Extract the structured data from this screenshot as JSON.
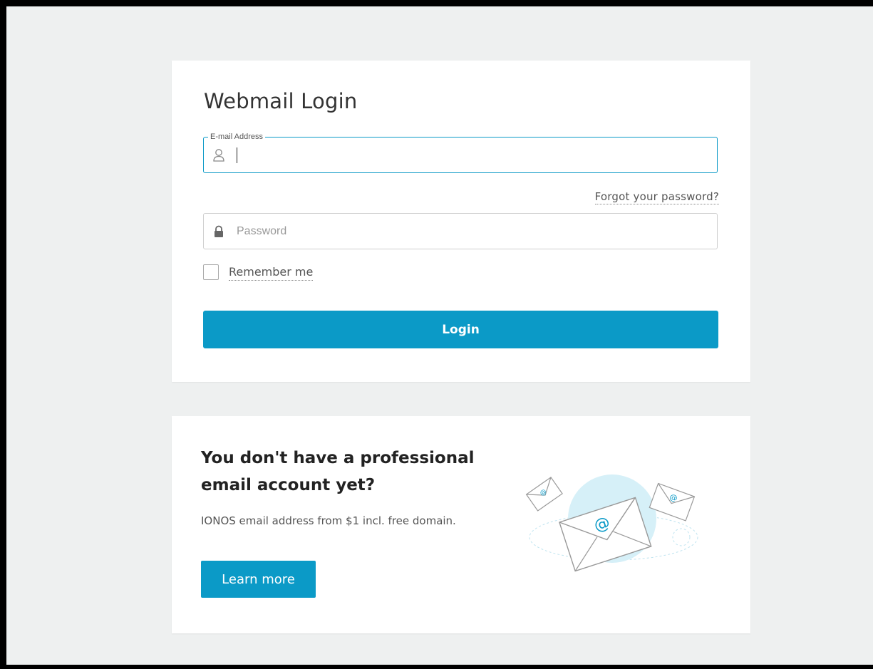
{
  "login": {
    "title": "Webmail Login",
    "email_label": "E-mail Address",
    "email_value": "",
    "password_placeholder": "Password",
    "password_value": "",
    "forgot_link": "Forgot your password?",
    "remember_label": "Remember me",
    "remember_checked": false,
    "login_button": "Login"
  },
  "promo": {
    "title": "You don't have a professional email account yet?",
    "text": "IONOS email address from $1 incl. free domain.",
    "button": "Learn more"
  },
  "icons": {
    "email_field": "user-icon",
    "password_field": "lock-icon",
    "illustration": "envelopes-at-icon"
  },
  "colors": {
    "accent": "#0b9ac7",
    "background": "#eef0f0",
    "card": "#ffffff",
    "text": "#333333"
  }
}
